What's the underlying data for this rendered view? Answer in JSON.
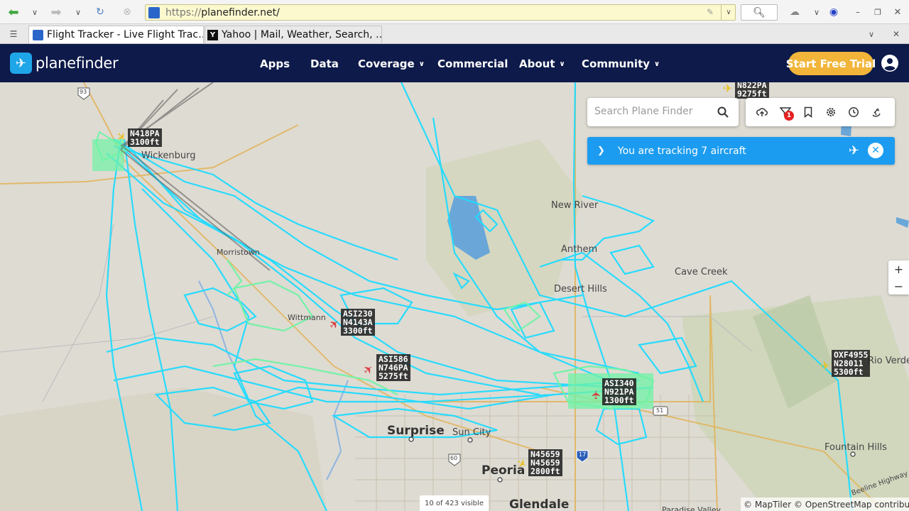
{
  "browser": {
    "url_proto": "https://",
    "url_host": "planefinder.net/",
    "tabs": [
      {
        "title": "Flight Tracker - Live Flight Trac…",
        "active": true
      },
      {
        "title": "Yahoo | Mail, Weather, Search, …",
        "active": false
      }
    ]
  },
  "nav": {
    "brand": "planefinder",
    "items": [
      {
        "label": "Apps",
        "has_menu": false
      },
      {
        "label": "Data",
        "has_menu": false
      },
      {
        "label": "Coverage",
        "has_menu": true
      },
      {
        "label": "Commercial",
        "has_menu": false
      },
      {
        "label": "About",
        "has_menu": true
      },
      {
        "label": "Community",
        "has_menu": true
      }
    ],
    "cta": "Start Free Trial",
    "colors": {
      "navbar": "#0d1a4a",
      "cta": "#f2b53a",
      "accent": "#1c9cf0"
    }
  },
  "map": {
    "search_placeholder": "Search Plane Finder",
    "filter_count": "1",
    "tracking_text": "You are tracking 7 aircraft",
    "zoom_in": "+",
    "zoom_out": "−",
    "visible_count": "10 of 423 visible",
    "attribution": "© MapTiler © OpenStreetMap contributors",
    "places": {
      "surprise": "Surprise",
      "sun_city": "Sun City",
      "peoria": "Peoria",
      "glendale": "Glendale",
      "new_river": "New River",
      "anthem": "Anthem",
      "cave_creek": "Cave Creek",
      "desert_hills": "Desert Hills",
      "fountain_hills": "Fountain Hills",
      "rio_verde": "Rio Verde",
      "wickenburg": "Wickenburg",
      "morristown": "Morristown",
      "wittmann": "Wittmann",
      "paradise_valley": "Paradise Valley",
      "beeline": "Beeline Highway",
      "route_93": "93",
      "route_60": "60",
      "route_17": "17",
      "route_51": "51"
    },
    "aircraft": [
      {
        "lines": "N822PA\n9275ft"
      },
      {
        "lines": "N418PA\n3100ft"
      },
      {
        "lines": "ASI230\nN4143A\n3300ft"
      },
      {
        "lines": "ASI586\nN746PA\n5275ft"
      },
      {
        "lines": "ASI340\nN921PA\n1300ft"
      },
      {
        "lines": "OXF4955\nN28011\n5300ft"
      },
      {
        "lines": "N45659\nN45659\n2800ft"
      }
    ]
  }
}
